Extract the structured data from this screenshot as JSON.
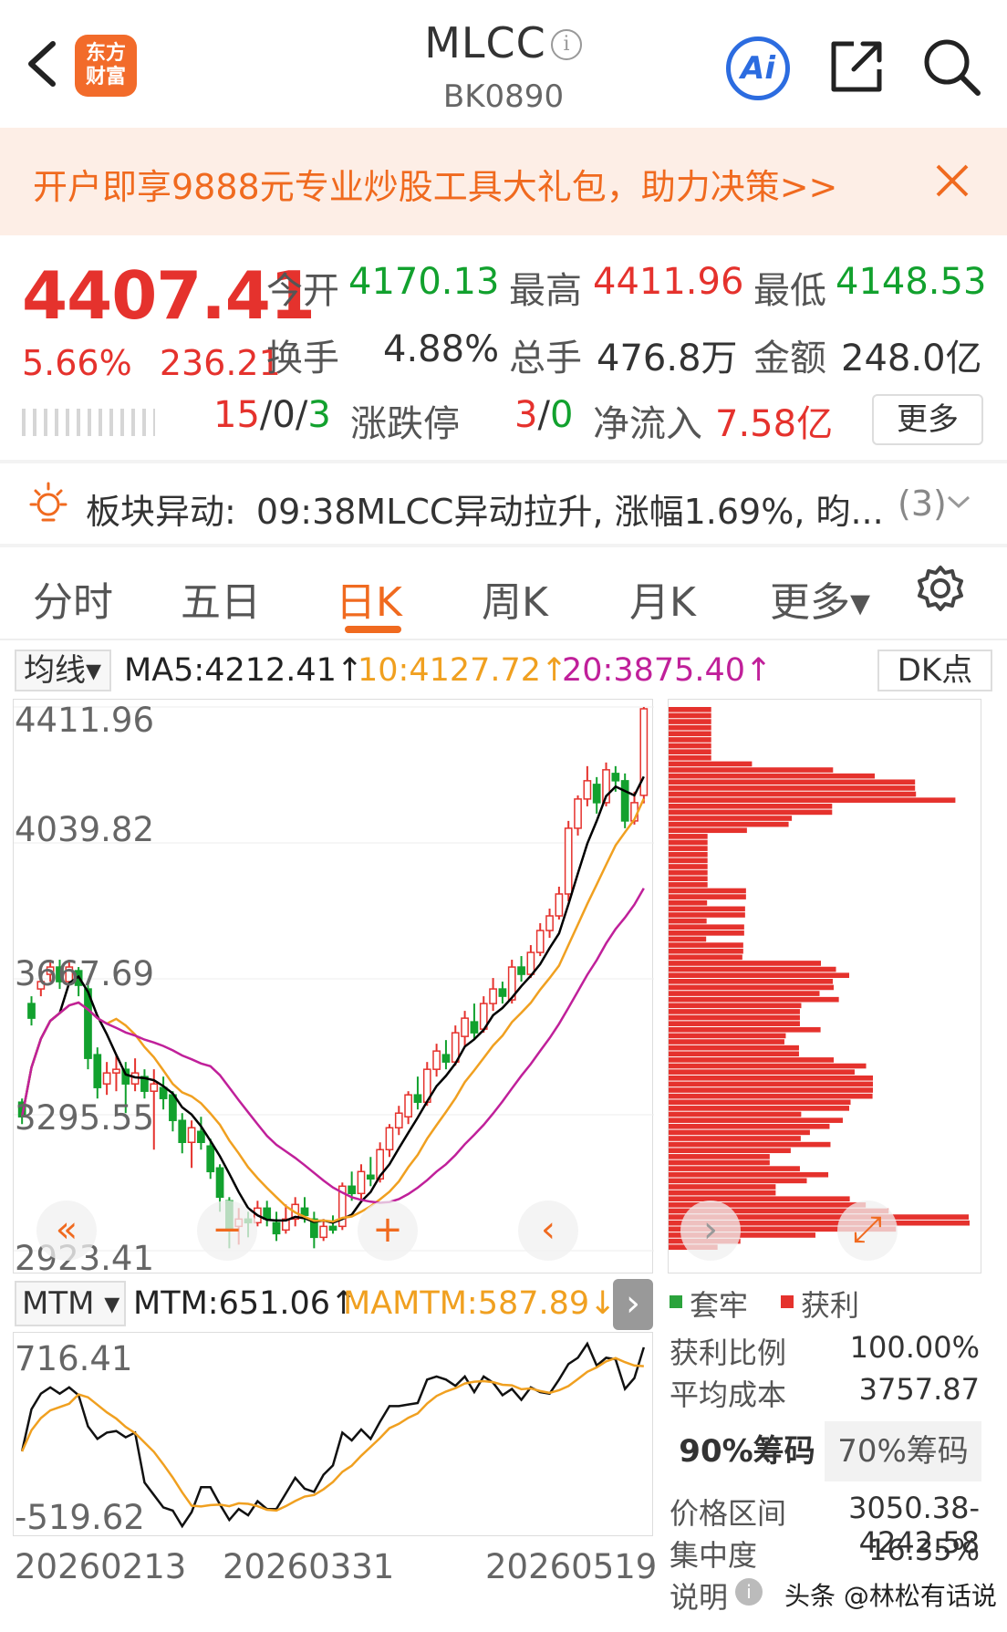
{
  "header": {
    "logo_text_line1": "东方",
    "logo_text_line2": "财富",
    "title": "MLCC",
    "code": "BK0890",
    "ai_label": "Ai"
  },
  "banner": {
    "text": "开户即享9888元专业炒股工具大礼包，助力决策>>"
  },
  "quote": {
    "price": "4407.41",
    "change_pct": "5.66%",
    "change_abs": "236.21",
    "open_label": "今开",
    "open_value": "4170.13",
    "high_label": "最高",
    "high_value": "4411.96",
    "low_label": "最低",
    "low_value": "4148.53",
    "turnover_label": "换手",
    "turnover_value": "4.88%",
    "volume_label": "总手",
    "volume_value": "476.8万",
    "amount_label": "金额",
    "amount_value": "248.0亿",
    "updown_a": "15",
    "updown_sep1": "/0/",
    "updown_b": "3",
    "limit_label": "涨跌停",
    "limit_a": "3",
    "limit_sep": "/",
    "limit_b": "0",
    "netflow_label": "净流入",
    "netflow_value": "7.58亿",
    "more_label": "更多"
  },
  "alert": {
    "label": "板块异动:",
    "text": "09:38MLCC异动拉升, 涨幅1.69%, 昀...",
    "count": "(3)"
  },
  "tabs": [
    "分时",
    "五日",
    "日K",
    "周K",
    "月K",
    "更多▾"
  ],
  "indicators": {
    "ma_select": "均线▾",
    "ma5": "MA5:4212.41↑",
    "ma10": "10:4127.72↑",
    "ma20": "20:3875.40↑",
    "dk_button": "DK点"
  },
  "kline": {
    "y_labels": [
      "4411.96",
      "4039.82",
      "3667.69",
      "3295.55",
      "2923.41"
    ]
  },
  "mtm": {
    "select": "MTM ▾",
    "value": "MTM:651.06↑",
    "ma_value": "MAMTM:587.89↓",
    "y_top": "716.41",
    "y_bottom": "-519.62"
  },
  "dates": [
    "20260213",
    "20260331",
    "20260519"
  ],
  "chip": {
    "legend_trapped": "套牢",
    "legend_profit": "获利",
    "profit_ratio_label": "获利比例",
    "profit_ratio_value": "100.00%",
    "avg_cost_label": "平均成本",
    "avg_cost_value": "3757.87",
    "tab_90": "90%筹码",
    "tab_70": "70%筹码",
    "price_range_label": "价格区间",
    "price_range_value": "3050.38-4242.58",
    "concentration_label": "集中度",
    "concentration_value": "16.35%",
    "note_label": "说明"
  },
  "watermark": "头条 @林松有话说",
  "colors": {
    "up": "#e5322d",
    "down": "#12a12e",
    "accent": "#f06a1f",
    "ma5": "#000000",
    "ma10": "#f0a020",
    "ma20": "#c0209a"
  },
  "chart_data": {
    "type": "candlestick",
    "y_axis_ticks": [
      4411.96,
      4039.82,
      3667.69,
      3295.55,
      2923.41
    ],
    "x_tick_labels": [
      "20260213",
      "20260331",
      "20260519"
    ],
    "series": [
      {
        "name": "MA5",
        "last": 4212.41
      },
      {
        "name": "MA10",
        "last": 4127.72
      },
      {
        "name": "MA20",
        "last": 3875.4
      }
    ],
    "candles": [
      [
        3330,
        3290,
        3340,
        3270
      ],
      [
        3600,
        3560,
        3620,
        3540
      ],
      [
        3640,
        3660,
        3690,
        3620
      ],
      [
        3680,
        3700,
        3720,
        3660
      ],
      [
        3700,
        3660,
        3720,
        3640
      ],
      [
        3660,
        3700,
        3720,
        3650
      ],
      [
        3690,
        3650,
        3700,
        3620
      ],
      [
        3640,
        3450,
        3650,
        3420
      ],
      [
        3460,
        3370,
        3480,
        3340
      ],
      [
        3380,
        3410,
        3440,
        3350
      ],
      [
        3410,
        3420,
        3460,
        3360
      ],
      [
        3420,
        3380,
        3440,
        3300
      ],
      [
        3380,
        3410,
        3450,
        3360
      ],
      [
        3400,
        3360,
        3420,
        3340
      ],
      [
        3360,
        3380,
        3420,
        3200
      ],
      [
        3370,
        3340,
        3400,
        3310
      ],
      [
        3350,
        3280,
        3360,
        3250
      ],
      [
        3280,
        3220,
        3300,
        3190
      ],
      [
        3220,
        3260,
        3280,
        3150
      ],
      [
        3250,
        3220,
        3290,
        3200
      ],
      [
        3210,
        3140,
        3230,
        3120
      ],
      [
        3150,
        3070,
        3160,
        3030
      ],
      [
        3060,
        2980,
        3070,
        2930
      ],
      [
        2990,
        3010,
        3040,
        2940
      ],
      [
        3010,
        3000,
        3030,
        2960
      ],
      [
        3000,
        3040,
        3060,
        2990
      ],
      [
        3040,
        3010,
        3060,
        2990
      ],
      [
        3000,
        2970,
        3030,
        2950
      ],
      [
        2980,
        3010,
        3050,
        2970
      ],
      [
        3010,
        3050,
        3070,
        2990
      ],
      [
        3040,
        3020,
        3070,
        3000
      ],
      [
        3010,
        2960,
        3030,
        2930
      ],
      [
        2960,
        2990,
        3010,
        2950
      ],
      [
        2990,
        2980,
        3020,
        2970
      ],
      [
        2990,
        3100,
        3110,
        2980
      ],
      [
        3100,
        3080,
        3140,
        3060
      ],
      [
        3080,
        3140,
        3160,
        3060
      ],
      [
        3130,
        3120,
        3180,
        3100
      ],
      [
        3120,
        3200,
        3220,
        3110
      ],
      [
        3200,
        3260,
        3270,
        3180
      ],
      [
        3260,
        3300,
        3320,
        3240
      ],
      [
        3290,
        3350,
        3360,
        3270
      ],
      [
        3350,
        3330,
        3400,
        3310
      ],
      [
        3330,
        3420,
        3440,
        3320
      ],
      [
        3420,
        3470,
        3490,
        3400
      ],
      [
        3460,
        3440,
        3500,
        3420
      ],
      [
        3440,
        3520,
        3540,
        3430
      ],
      [
        3510,
        3560,
        3580,
        3480
      ],
      [
        3550,
        3520,
        3600,
        3500
      ],
      [
        3530,
        3600,
        3620,
        3520
      ],
      [
        3600,
        3640,
        3670,
        3580
      ],
      [
        3640,
        3620,
        3660,
        3600
      ],
      [
        3610,
        3700,
        3720,
        3600
      ],
      [
        3700,
        3680,
        3730,
        3660
      ],
      [
        3680,
        3740,
        3760,
        3670
      ],
      [
        3740,
        3800,
        3820,
        3730
      ],
      [
        3800,
        3840,
        3860,
        3780
      ],
      [
        3840,
        3900,
        3920,
        3830
      ],
      [
        3900,
        4080,
        4100,
        3880
      ],
      [
        4080,
        4160,
        4170,
        4060
      ],
      [
        4160,
        4210,
        4250,
        4140
      ],
      [
        4200,
        4150,
        4220,
        4120
      ],
      [
        4150,
        4240,
        4260,
        4140
      ],
      [
        4230,
        4210,
        4250,
        4180
      ],
      [
        4210,
        4100,
        4230,
        4080
      ],
      [
        4100,
        4150,
        4180,
        4090
      ],
      [
        4170,
        4407,
        4412,
        4148
      ]
    ]
  }
}
